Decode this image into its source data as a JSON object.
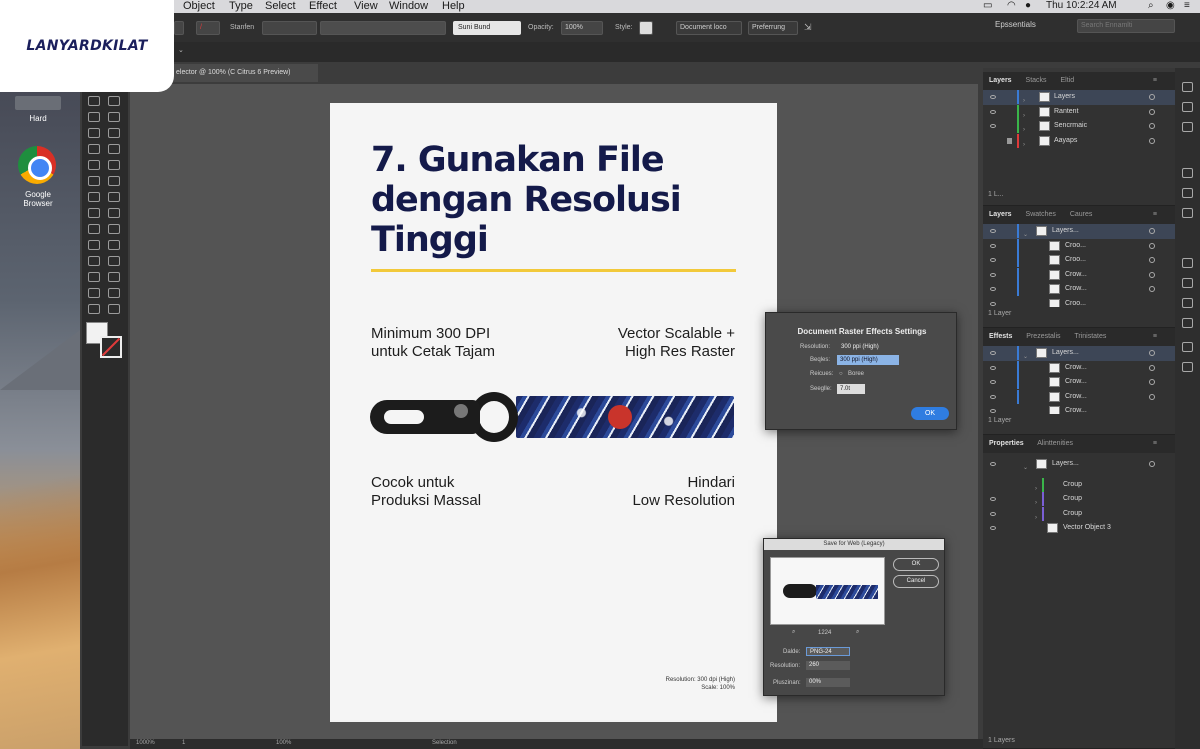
{
  "logo": {
    "text": "LANYARDKILAT"
  },
  "desktop": {
    "icons": [
      {
        "label": "Hard"
      },
      {
        "label": "Google Browser"
      }
    ]
  },
  "menubar": {
    "items": [
      "Object",
      "Type",
      "Select",
      "Effect",
      "View",
      "Window",
      "Help"
    ],
    "clock": "Thu 10:2:24 AM"
  },
  "controlbar": {
    "stroke_label": "Stanfen",
    "brush_value": "Suni Bund",
    "opacity_label": "Opacity:",
    "opacity_value": "100%",
    "style_label": "Style:",
    "document_button": "Document loco",
    "preferences_button": "Preferrung",
    "workspace": "Epssentials",
    "search_placeholder": "Search Ennamlti"
  },
  "document_tab": {
    "label": "elector @ 100% (C Citrus 6 Preview)"
  },
  "artboard": {
    "title_lines": [
      "7. Gunakan File",
      "dengan Resolusi",
      "Tinggi"
    ],
    "top_left": [
      "Minimum 300 DPI",
      "untuk Cetak Tajam"
    ],
    "top_right": [
      "Vector Scalable +",
      "High Res Raster"
    ],
    "bottom_left": [
      "Cocok untuk",
      "Produksi Massal"
    ],
    "bottom_right": [
      "Hindari",
      "Low Resolution"
    ],
    "resolution_note": [
      "Resolution: 300 dpi (High)",
      "Scale: 100%"
    ]
  },
  "panels": {
    "layers": {
      "tabs": [
        "Layers",
        "Stacks",
        "Eltid"
      ],
      "rows": [
        {
          "name": "Layers",
          "color": "#3a7bd5"
        },
        {
          "name": "Rantent",
          "color": "#3ab54a"
        },
        {
          "name": "Sencrmaic",
          "color": "#3ab54a"
        },
        {
          "name": "Aayaps",
          "color": "#e03a3a"
        }
      ],
      "footer": "1 L..."
    },
    "layers2": {
      "tabs": [
        "Layers",
        "Swatches",
        "Caures"
      ],
      "rows": [
        {
          "name": "Layers..."
        },
        {
          "name": "Croo..."
        },
        {
          "name": "Croo..."
        },
        {
          "name": "Crow..."
        },
        {
          "name": "Crow..."
        },
        {
          "name": "Croo..."
        }
      ],
      "footer": "1 Layer"
    },
    "effects": {
      "tabs": [
        "Effests",
        "Prezestalis",
        "Trinistates"
      ],
      "rows": [
        {
          "name": "Layers..."
        },
        {
          "name": "Crow..."
        },
        {
          "name": "Crow..."
        },
        {
          "name": "Crow..."
        },
        {
          "name": "Crow..."
        }
      ],
      "footer": "1 Layer"
    },
    "properties": {
      "tabs": [
        "Properties",
        "Alinttenities"
      ],
      "rows": [
        {
          "name": "Layers..."
        },
        {
          "name": "Croup"
        },
        {
          "name": "Croup"
        },
        {
          "name": "Croup"
        },
        {
          "name": "Vector Object 3"
        }
      ],
      "footer": "1 Layers"
    }
  },
  "dialog_raster": {
    "title": "Document Raster Effects Settings",
    "resolution_label": "Resolution:",
    "resolution_value": "300 ppi (High)",
    "background_label": "Beqles:",
    "background_value": "300 ppi (High)",
    "antialias_label": "Reicues:",
    "antialias_value": "Boree",
    "add_label": "Seeglle:",
    "add_value": "7.0t",
    "ok": "OK"
  },
  "dialog_save": {
    "title": "Save for Web (Legacy)",
    "ok": "OK",
    "cancel": "Cancel",
    "zoom": "1224",
    "preset_label": "Dalde:",
    "preset_value": "PNG-24",
    "resolution_label": "Resolution:",
    "resolution_value": "260",
    "position_label": "Pluszinan:",
    "position_value": "00%"
  },
  "statusbar": {
    "zoom": "1000%",
    "artboard": "1",
    "percent": "100%",
    "selection": "Selection"
  }
}
